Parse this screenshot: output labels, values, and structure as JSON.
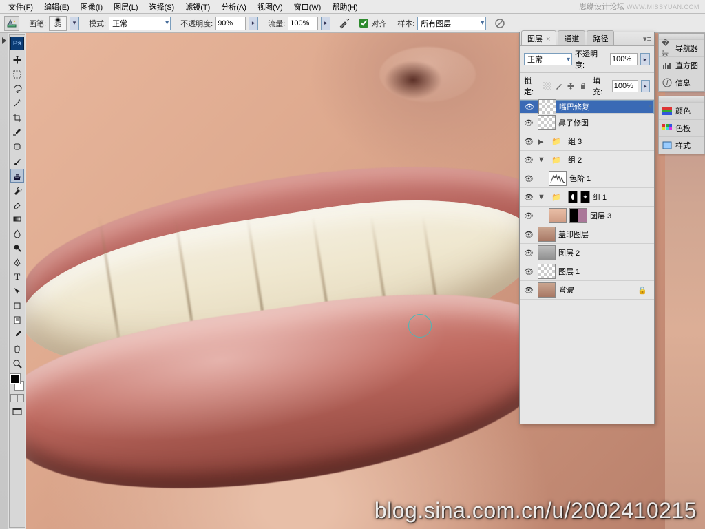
{
  "brand": {
    "cn": "思缘设计论坛",
    "url": "WWW.MISSYUAN.COM"
  },
  "menu": {
    "file": "文件(F)",
    "edit": "编辑(E)",
    "image": "图像(I)",
    "layer": "图层(L)",
    "select": "选择(S)",
    "filter": "滤镜(T)",
    "analysis": "分析(A)",
    "view": "视图(V)",
    "window": "窗口(W)",
    "help": "帮助(H)"
  },
  "optbar": {
    "brush": "画笔:",
    "brush_size": "35",
    "mode": "模式:",
    "mode_value": "正常",
    "opacity": "不透明度:",
    "opacity_value": "90%",
    "flow": "流量:",
    "flow_value": "100%",
    "aligned": "对齐",
    "sample": "样本:",
    "sample_value": "所有图层"
  },
  "layers_panel": {
    "tabs": {
      "layers": "图层",
      "channels": "通道",
      "paths": "路径"
    },
    "blend_mode": "正常",
    "opacity_label": "不透明度:",
    "opacity_value": "100%",
    "lock_label": "锁定:",
    "fill_label": "填充:",
    "fill_value": "100%",
    "items": [
      {
        "name": "嘴巴修复"
      },
      {
        "name": "鼻子修图"
      },
      {
        "name": "组 3"
      },
      {
        "name": "组 2"
      },
      {
        "name": "色阶 1"
      },
      {
        "name": "组 1"
      },
      {
        "name": "图层 3"
      },
      {
        "name": "盖印图层"
      },
      {
        "name": "图层 2"
      },
      {
        "name": "图层 1"
      },
      {
        "name": "背景"
      }
    ]
  },
  "dock": {
    "navigator": "导航器",
    "histogram": "直方图",
    "info": "信息",
    "color": "颜色",
    "swatches": "色板",
    "styles": "样式"
  },
  "watermark": "blog.sina.com.cn/u/2002410215"
}
